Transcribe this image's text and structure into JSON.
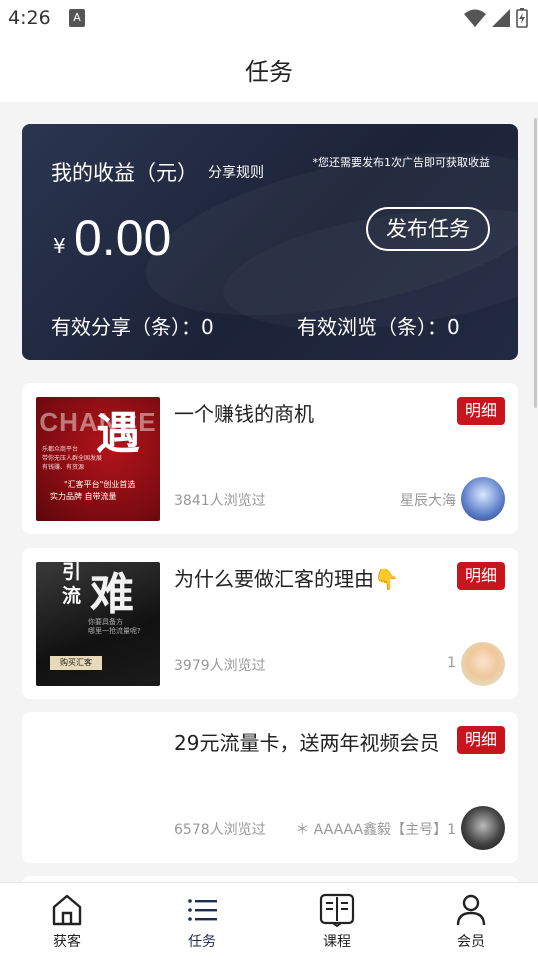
{
  "status_bar": {
    "time": "4:26",
    "notification_glyph": "A"
  },
  "header": {
    "title": "任务"
  },
  "earnings": {
    "title": "我的收益（元）",
    "rules_link": "分享规则",
    "hint": "*您还需要发布1次广告即可获取收益",
    "currency": "¥",
    "amount": "0.00",
    "publish_button": "发布任务",
    "valid_shares": "有效分享（条）：0",
    "valid_views": "有效浏览（条）：0"
  },
  "tasks": [
    {
      "title": "一个赚钱的商机",
      "badge": "明细",
      "views": "3841人浏览过",
      "author": "星辰大海",
      "thumb": {
        "big_text": "CHANCE",
        "char": "遇",
        "lines": [
          "乐都众商平台",
          "带你无压人群全国发展",
          "有钱赚、有资源"
        ],
        "quote": "\"汇客平台\"创业首选",
        "footer": "实力品牌 自带流量"
      }
    },
    {
      "title": "为什么要做汇客的理由👇",
      "badge": "明细",
      "views": "3979人浏览过",
      "author": "1",
      "thumb": {
        "line1": "引",
        "line2": "流",
        "big": "难",
        "question": "你要具备方\n哪里一抢流量呢?",
        "button": "购买汇客"
      }
    },
    {
      "title": "29元流量卡，送两年视频会员",
      "badge": "明细",
      "views": "6578人浏览过",
      "author": "＊ AAAAA鑫毅【主号】1"
    }
  ],
  "tabs": [
    {
      "label": "获客",
      "icon": "home-icon"
    },
    {
      "label": "任务",
      "icon": "list-icon"
    },
    {
      "label": "课程",
      "icon": "book-icon"
    },
    {
      "label": "会员",
      "icon": "person-icon"
    }
  ],
  "colors": {
    "accent": "#c8151d",
    "card_dark": "#1c2338",
    "tab_active": "#1f2a55"
  }
}
